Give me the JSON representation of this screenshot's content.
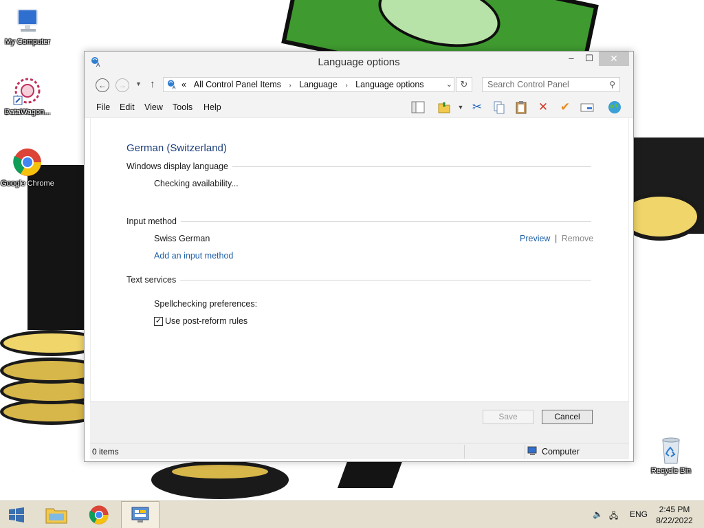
{
  "desktop": {
    "icons": [
      {
        "label": "My Computer"
      },
      {
        "label": "DataWagon..."
      },
      {
        "label": "Google Chrome"
      },
      {
        "label": "Recycle Bin"
      }
    ]
  },
  "window": {
    "title": "Language options",
    "controls": {
      "minimize": "–",
      "maximize": "☐",
      "close": "✕"
    }
  },
  "addressbar": {
    "overflow": "«",
    "breadcrumbs": [
      "All Control Panel Items",
      "Language",
      "Language options"
    ],
    "separator": "›",
    "search_placeholder": "Search Control Panel"
  },
  "menu": {
    "items": [
      "File",
      "Edit",
      "View",
      "Tools",
      "Help"
    ]
  },
  "content": {
    "language_name": "German (Switzerland)",
    "display_language": {
      "heading": "Windows display language",
      "status": "Checking availability..."
    },
    "input_method": {
      "heading": "Input method",
      "method": "Swiss German",
      "preview_link": "Preview",
      "divider": "|",
      "remove_link": "Remove",
      "add_link": "Add an input method"
    },
    "text_services": {
      "heading": "Text services",
      "spellcheck_label": "Spellchecking preferences:",
      "post_reform_label": "Use post-reform rules",
      "post_reform_checked": true
    }
  },
  "footer": {
    "save_label": "Save",
    "cancel_label": "Cancel"
  },
  "statusbar": {
    "items_count": "0 items",
    "location": "Computer"
  },
  "taskbar": {
    "language": "ENG",
    "time": "2:45 PM",
    "date": "8/22/2022"
  },
  "colors": {
    "accent_link": "#1e5fa8",
    "heading_blue": "#1e3f7a",
    "taskbar": "#e4dfcf"
  }
}
